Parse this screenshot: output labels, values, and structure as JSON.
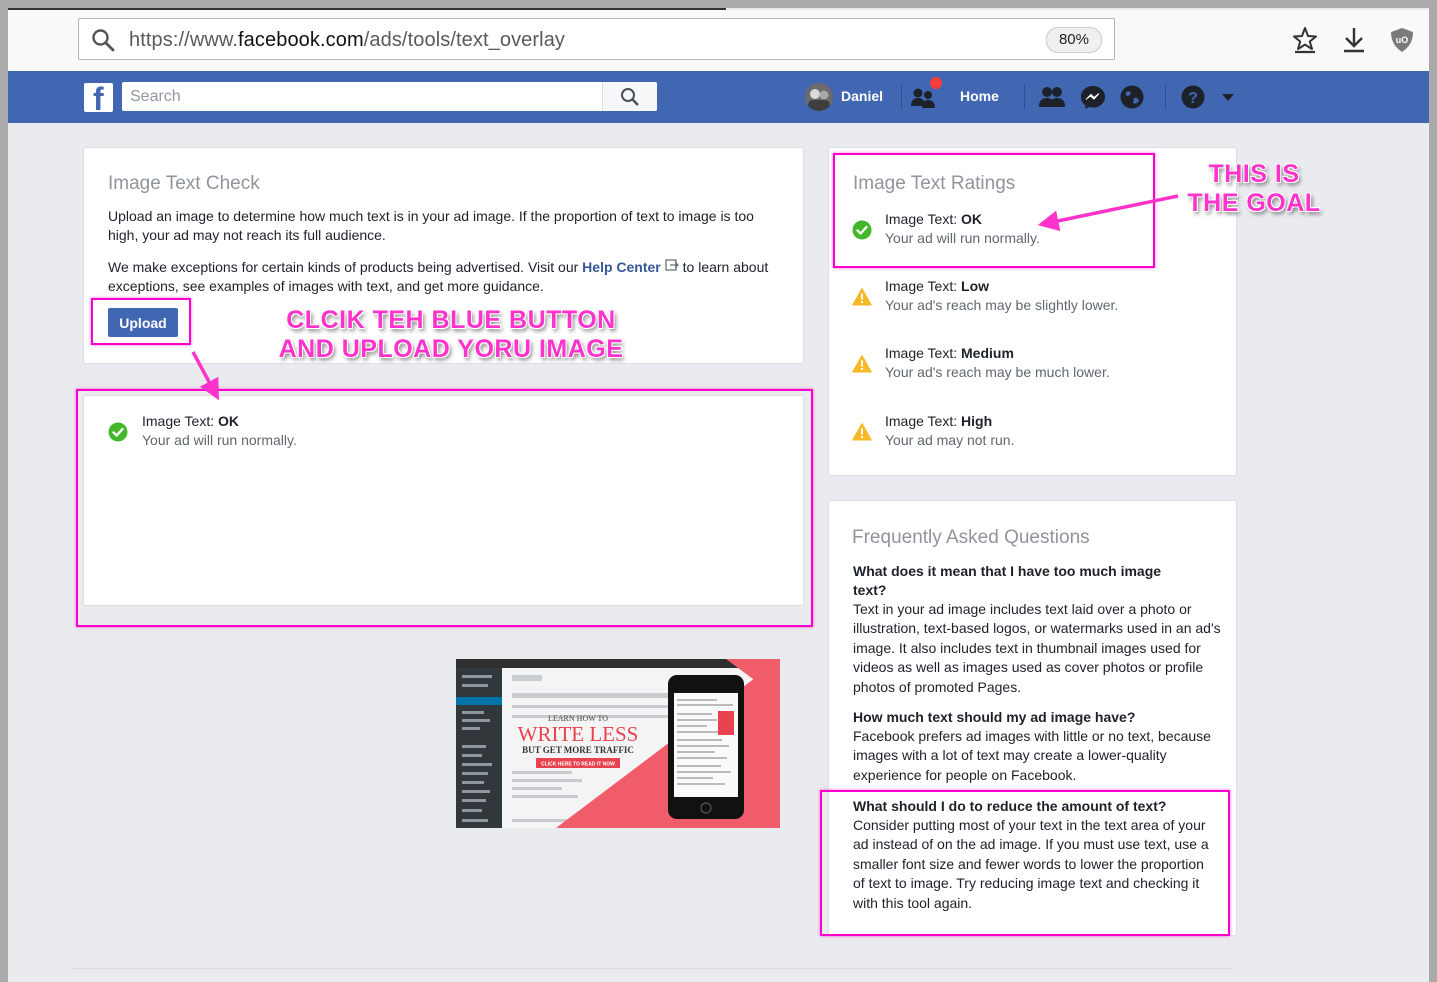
{
  "browser": {
    "url_prefix": "https://www.",
    "url_domain": "facebook.com",
    "url_path": "/ads/tools/text_overlay",
    "zoom": "80%",
    "icons": [
      "search-icon",
      "bookmarks-star-icon",
      "download-icon",
      "ublock-shield-icon"
    ]
  },
  "fb_header": {
    "search_placeholder": "Search",
    "user_name": "Daniel",
    "home_label": "Home",
    "brand_color": "#4267b2",
    "notification_color": "#fa3e3e"
  },
  "check_card": {
    "title": "Image Text Check",
    "paragraph1": "Upload an image to determine how much text is in your ad image. If the proportion of text to image is too high, your ad may not reach its full audience.",
    "paragraph2_before": "We make exceptions for certain kinds of products being advertised. Visit our ",
    "help_link": "Help Center",
    "paragraph2_after": " to learn about exceptions, see examples of images with text, and get more guidance.",
    "upload_label": "Upload"
  },
  "result_card": {
    "label_prefix": "Image Text: ",
    "label_value": "OK",
    "desc": "Your ad will run normally.",
    "thumbnail": {
      "headline_small": "LEARN HOW TO",
      "headline_big": "WRITE LESS",
      "headline_sub": "BUT GET MORE TRAFFIC",
      "cta": "CLICK HERE TO READ IT NOW"
    }
  },
  "ratings_card": {
    "title": "Image Text Ratings",
    "items": [
      {
        "prefix": "Image Text: ",
        "level": "OK",
        "desc": "Your ad will run normally.",
        "status": "ok"
      },
      {
        "prefix": "Image Text: ",
        "level": "Low",
        "desc": "Your ad's reach may be slightly lower.",
        "status": "warn"
      },
      {
        "prefix": "Image Text: ",
        "level": "Medium",
        "desc": "Your ad's reach may be much lower.",
        "status": "warn"
      },
      {
        "prefix": "Image Text: ",
        "level": "High",
        "desc": "Your ad may not run.",
        "status": "warn"
      }
    ],
    "ok_color": "#42b72a",
    "warn_color": "#f7b928"
  },
  "faq_card": {
    "title": "Frequently Asked Questions",
    "items": [
      {
        "q": "What does it mean that I have too much image text?",
        "a": "Text in your ad image includes text laid over a photo or illustration, text-based logos, or watermarks used in an ad's image. It also includes text in thumbnail images used for videos as well as images used as cover photos or profile photos of promoted Pages."
      },
      {
        "q": "How much text should my ad image have?",
        "a": "Facebook prefers ad images with little or no text, because images with a lot of text may create a lower-quality experience for people on Facebook."
      },
      {
        "q": "What should I do to reduce the amount of text?",
        "a": "Consider putting most of your text in the text area of your ad instead of on the ad image. If you must use text, use a smaller font size and fewer words to lower the proportion of text to image. Try reducing image text and checking it with this tool again."
      }
    ]
  },
  "annotations": {
    "goal_line1": "THIS IS",
    "goal_line2": "THE GOAL",
    "click_line1": "CLCIK TEH BLUE BUTTON",
    "click_line2": "AND UPLOAD YORU IMAGE",
    "color": "#ff00cc"
  }
}
